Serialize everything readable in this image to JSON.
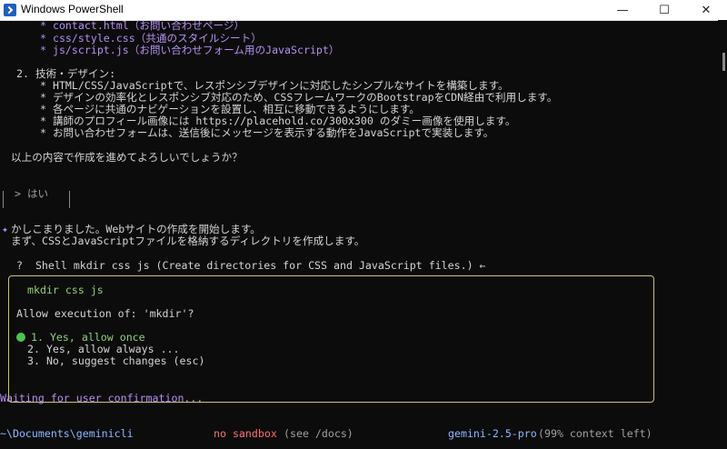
{
  "window": {
    "title": "Windows PowerShell",
    "icon": "powershell-icon",
    "minimize": "—",
    "maximize": "☐",
    "close": "✕"
  },
  "lines": {
    "l1": "* contact.html（お問い合わせページ）",
    "l2": "* css/style.css（共通のスタイルシート）",
    "l3": "* js/script.js（お問い合わせフォーム用のJavaScript）",
    "l4": "2. 技術・デザイン:",
    "l5": "* HTML/CSS/JavaScriptで、レスポンシブデザインに対応したシンプルなサイトを構築します。",
    "l6": "* デザインの効率化とレスポンシブ対応のため、CSSフレームワークのBootstrapをCDN経由で利用します。",
    "l7": "* 各ページに共通のナビゲーションを設置し、相互に移動できるようにします。",
    "l8": "* 講師のプロフィール画像には https://placehold.co/300x300 のダミー画像を使用します。",
    "l9": "* お問い合わせフォームは、送信後にメッセージを表示する動作をJavaScriptで実装します。",
    "l10": "以上の内容で作成を進めてよろしいでしょうか？",
    "l11": "> はい",
    "l12_marker": "✦",
    "l12": "かしこまりました。Webサイトの作成を開始します。",
    "l13": "まず、CSSとJavaScriptファイルを格納するディレクトリを作成します。",
    "p1": "?  Shell mkdir css js (Create directories for CSS and JavaScript files.) ←",
    "p2": "mkdir css js",
    "p3": "Allow execution of: 'mkdir'?",
    "p4": "1. Yes, allow once",
    "p5": "2. Yes, allow always ...",
    "p6": "3. No, suggest changes (esc)",
    "w1": "Waiting for user confirmation..."
  },
  "status": {
    "path": "~\\Documents\\geminicli",
    "sandbox": "no sandbox",
    "sandbox_hint": "(see /docs)",
    "model": "gemini-2.5-pro",
    "context": "(99% context left)"
  },
  "colors": {
    "background": "#0c0c0c",
    "accent_purple": "#b48ff0",
    "accent_green": "#8fd17a",
    "accent_red": "#ff6f6f",
    "border_yellow": "#c9c47a"
  }
}
